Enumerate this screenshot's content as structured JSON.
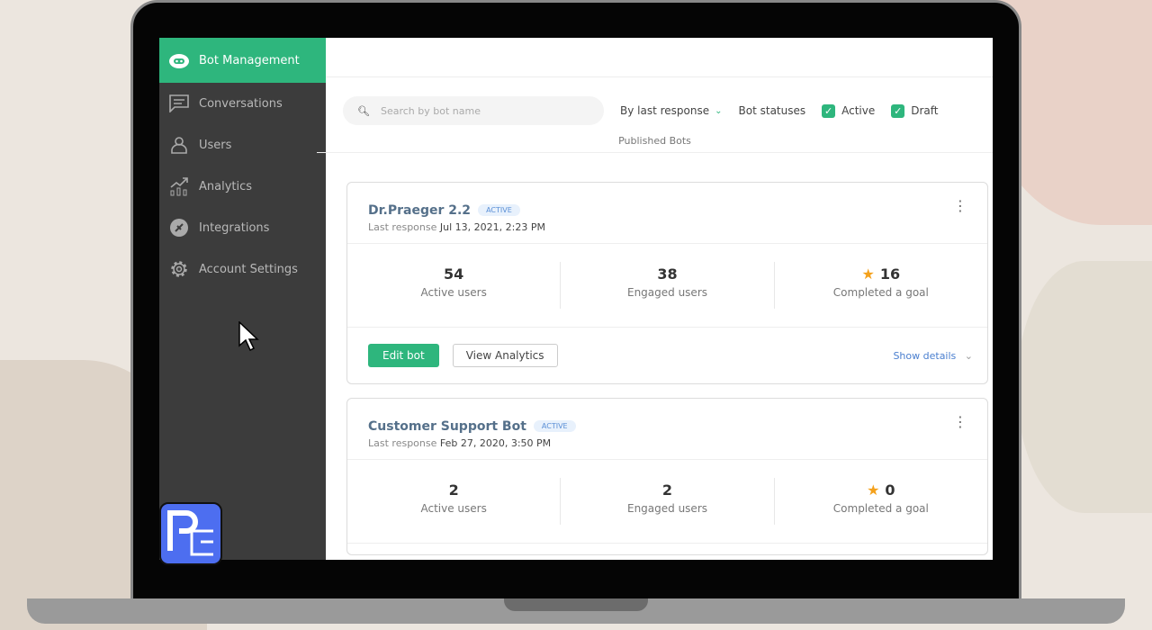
{
  "sidebar": {
    "items": [
      {
        "label": "Bot Management",
        "icon": "robot-icon",
        "active": true
      },
      {
        "label": "Conversations",
        "icon": "chat-icon"
      },
      {
        "label": "Users",
        "icon": "user-icon"
      },
      {
        "label": "Analytics",
        "icon": "analytics-icon"
      },
      {
        "label": "Integrations",
        "icon": "plug-icon"
      },
      {
        "label": "Account Settings",
        "icon": "gear-icon"
      }
    ]
  },
  "filters": {
    "search_placeholder": "Search by bot name",
    "sort": "By last response",
    "statuses_label": "Bot statuses",
    "active": "Active",
    "draft": "Draft"
  },
  "section": "Published Bots",
  "bots": [
    {
      "name": "Dr.Praeger 2.2",
      "status": "ACTIVE",
      "last_label": "Last response",
      "last": "Jul 13, 2021, 2:23 PM",
      "active_users": "54",
      "active_users_label": "Active users",
      "engaged": "38",
      "engaged_label": "Engaged users",
      "goal": "16",
      "goal_label": "Completed a goal",
      "edit": "Edit bot",
      "view": "View Analytics",
      "details": "Show details"
    },
    {
      "name": "Customer Support Bot",
      "status": "ACTIVE",
      "last_label": "Last response",
      "last": "Feb 27, 2020, 3:50 PM",
      "active_users": "2",
      "active_users_label": "Active users",
      "engaged": "2",
      "engaged_label": "Engaged users",
      "goal": "0",
      "goal_label": "Completed a goal"
    }
  ],
  "colors": {
    "accent": "#2eb67d",
    "sidebar": "#3c3c3c"
  }
}
